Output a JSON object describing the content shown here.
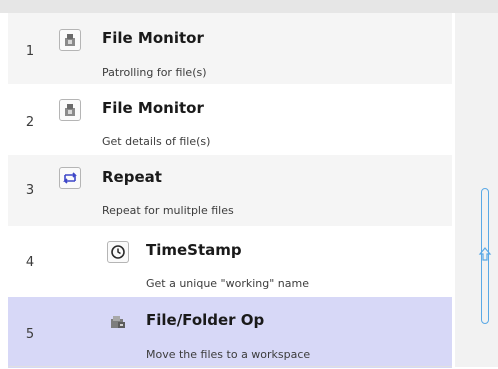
{
  "steps": [
    {
      "number": "1",
      "icon": "file-monitor-icon",
      "title": "File Monitor",
      "description": "Patrolling for file(s)"
    },
    {
      "number": "2",
      "icon": "file-monitor-icon",
      "title": "File Monitor",
      "description": "Get details of file(s)"
    },
    {
      "number": "3",
      "icon": "repeat-icon",
      "title": "Repeat",
      "description": "Repeat for mulitple files"
    },
    {
      "number": "4",
      "icon": "clock-icon",
      "title": "TimeStamp",
      "description": "Get a unique \"working\" name"
    },
    {
      "number": "5",
      "icon": "file-folder-op-icon",
      "title": "File/Folder Op",
      "description": "Move the files to a workspace"
    }
  ],
  "selected_step": "5",
  "colors": {
    "selected_row": "#d7d8f7",
    "scroll_handle": "#5aa9e6",
    "repeat_icon": "#3d46c8"
  }
}
